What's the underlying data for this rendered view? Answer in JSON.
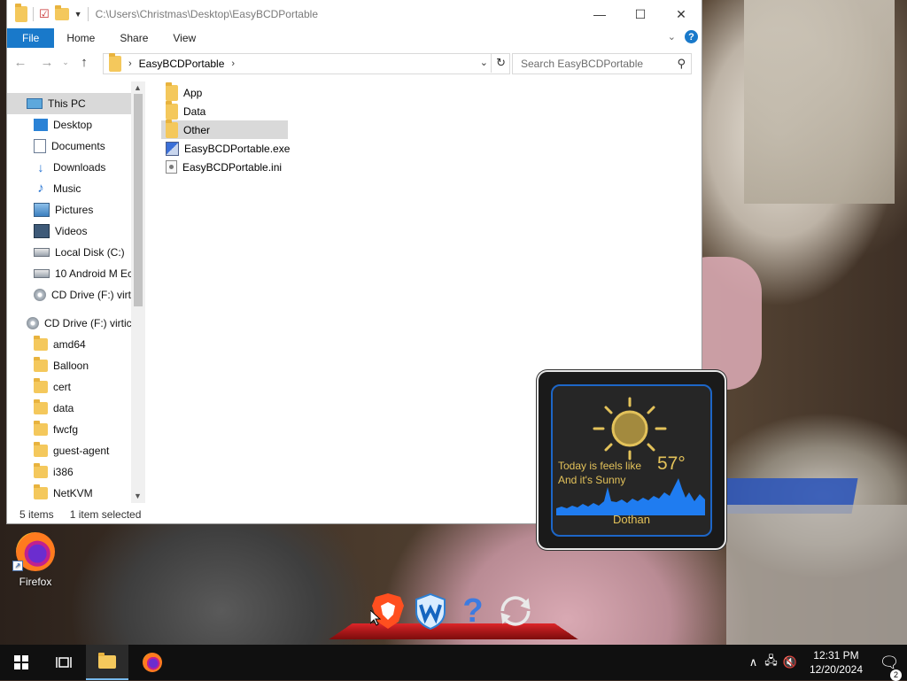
{
  "window": {
    "title_path": "C:\\Users\\Christmas\\Desktop\\EasyBCDPortable",
    "controls": {
      "minimize": "—",
      "maximize": "☐",
      "close": "✕"
    }
  },
  "ribbon": {
    "tabs": [
      {
        "label": "File"
      },
      {
        "label": "Home"
      },
      {
        "label": "Share"
      },
      {
        "label": "View"
      }
    ],
    "help": "?"
  },
  "address": {
    "segments": [
      "EasyBCDPortable"
    ],
    "search_placeholder": "Search EasyBCDPortable"
  },
  "nav_pane": {
    "items": [
      {
        "label": "This PC",
        "icon": "computer-icon",
        "selected": true
      },
      {
        "label": "Desktop",
        "icon": "desktop-icon"
      },
      {
        "label": "Documents",
        "icon": "documents-icon"
      },
      {
        "label": "Downloads",
        "icon": "downloads-icon"
      },
      {
        "label": "Music",
        "icon": "music-icon"
      },
      {
        "label": "Pictures",
        "icon": "pictures-icon"
      },
      {
        "label": "Videos",
        "icon": "videos-icon"
      },
      {
        "label": "Local Disk (C:)",
        "icon": "drive-icon"
      },
      {
        "label": "10 Android M Ec",
        "icon": "drive-icon"
      },
      {
        "label": "CD Drive (F:) virt",
        "icon": "cd-drive-icon"
      },
      {
        "label": "CD Drive (F:) virtic",
        "icon": "cd-drive-icon"
      },
      {
        "label": "amd64",
        "icon": "folder-icon"
      },
      {
        "label": "Balloon",
        "icon": "folder-icon"
      },
      {
        "label": "cert",
        "icon": "folder-icon"
      },
      {
        "label": "data",
        "icon": "folder-icon"
      },
      {
        "label": "fwcfg",
        "icon": "folder-icon"
      },
      {
        "label": "guest-agent",
        "icon": "folder-icon"
      },
      {
        "label": "i386",
        "icon": "folder-icon"
      },
      {
        "label": "NetKVM",
        "icon": "folder-icon"
      }
    ]
  },
  "files": [
    {
      "name": "App",
      "type": "folder"
    },
    {
      "name": "Data",
      "type": "folder"
    },
    {
      "name": "Other",
      "type": "folder",
      "selected": true
    },
    {
      "name": "EasyBCDPortable.exe",
      "type": "exe"
    },
    {
      "name": "EasyBCDPortable.ini",
      "type": "ini"
    }
  ],
  "status": {
    "count": "5 items",
    "selection": "1 item selected"
  },
  "desktop": {
    "icons": [
      {
        "label": "Firefox",
        "icon": "firefox-icon"
      }
    ]
  },
  "weather": {
    "line1": "Today is feels like",
    "line2": "And it's Sunny",
    "temperature": "57°",
    "city": "Dothan",
    "color": "#e3c25a",
    "frame_color": "#1d66c7"
  },
  "dock": {
    "apps": [
      "brave-browser-icon",
      "wise-care-icon",
      "help-icon",
      "sync-icon"
    ]
  },
  "taskbar": {
    "time": "12:31 PM",
    "date": "12/20/2024",
    "notification_count": "2",
    "pinned": [
      "start-icon",
      "task-view-icon",
      "file-explorer-icon",
      "firefox-icon"
    ]
  }
}
